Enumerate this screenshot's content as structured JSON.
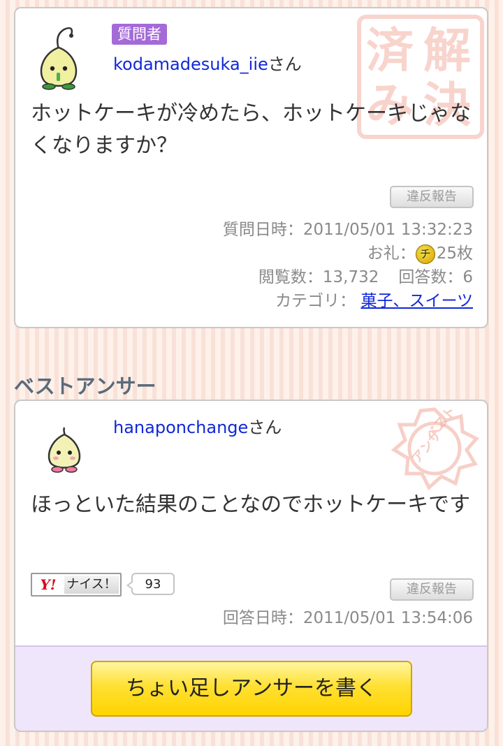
{
  "question": {
    "role_badge": "質問者",
    "username": "kodamadesuka_iie",
    "honorific": "さん",
    "text": "ホットケーキが冷めたら、ホットケーキじゃなくなりますか？",
    "stamp_text": "解決済み",
    "report_label": "違反報告",
    "posted_label": "質問日時：",
    "posted_value": "2011/05/01 13:32:23",
    "reward_label": "お礼：",
    "reward_icon": "チ",
    "reward_value": "25枚",
    "views_label": "閲覧数：",
    "views_value": "13,732",
    "answers_label": "回答数：",
    "answers_value": "6",
    "category_label": "カテゴリ：",
    "category_value": "菓子、スイーツ"
  },
  "best_answer": {
    "heading": "ベストアンサー",
    "username": "hanaponchange",
    "honorific": "さん",
    "text": "ほっといた結果のことなのでホットケーキです",
    "stamp_text": "ベストアンサー",
    "nice_logo": "Y!",
    "nice_label": "ナイス！",
    "nice_count": "93",
    "report_label": "違反報告",
    "answered_label": "回答日時：",
    "answered_value": "2011/05/01 13:54:06",
    "cta_label": "ちょい足しアンサーを書く"
  },
  "colors": {
    "accent_purple": "#a46ad8",
    "link_blue": "#1028d8",
    "cta_yellow": "#ffe033",
    "stamp_red": "#f0a090"
  }
}
